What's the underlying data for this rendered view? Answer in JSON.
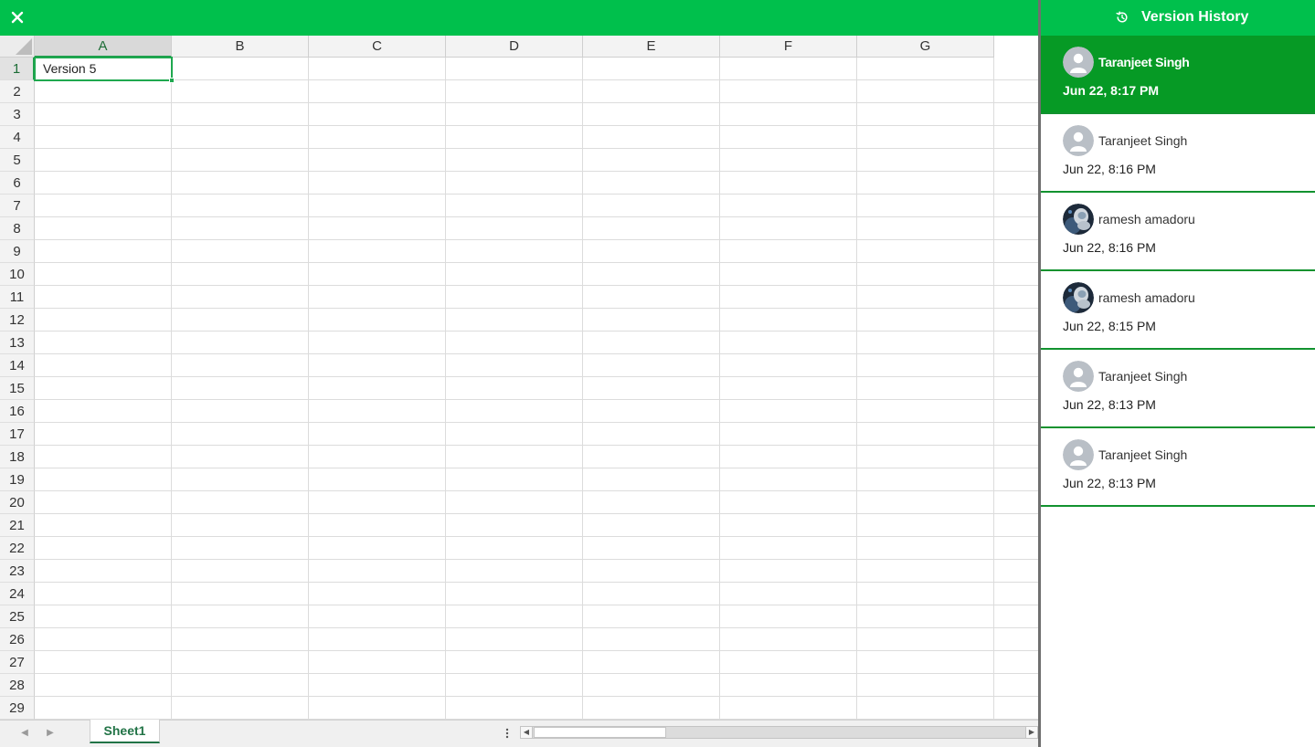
{
  "app": {
    "close_icon": "close-icon"
  },
  "sheet": {
    "columns": [
      "A",
      "B",
      "C",
      "D",
      "E",
      "F",
      "G"
    ],
    "rows": [
      "1",
      "2",
      "3",
      "4",
      "5",
      "6",
      "7",
      "8",
      "9",
      "10",
      "11",
      "12",
      "13",
      "14",
      "15",
      "16",
      "17",
      "18",
      "19",
      "20",
      "21",
      "22",
      "23",
      "24",
      "25",
      "26",
      "27",
      "28",
      "29"
    ],
    "selected_cell": "A1",
    "cells": [
      {
        "ref": "A1",
        "value": "Version 5"
      }
    ],
    "active_tab": "Sheet1"
  },
  "colors": {
    "accent_green": "#00c04c",
    "active_item_green": "#069a25",
    "sheet_tab_green": "#217346"
  },
  "version_history": {
    "title": "Version History",
    "header_icon": "history-icon",
    "items": [
      {
        "author": "Taranjeet Singh",
        "date": "Jun 22, 8:17 PM",
        "avatar": "default-avatar-icon",
        "active": true
      },
      {
        "author": "Taranjeet Singh",
        "date": "Jun 22, 8:16 PM",
        "avatar": "default-avatar-icon",
        "active": false
      },
      {
        "author": "ramesh amadoru",
        "date": "Jun 22, 8:16 PM",
        "avatar": "photo-avatar",
        "active": false
      },
      {
        "author": "ramesh amadoru",
        "date": "Jun 22, 8:15 PM",
        "avatar": "photo-avatar",
        "active": false
      },
      {
        "author": "Taranjeet Singh",
        "date": "Jun 22, 8:13 PM",
        "avatar": "default-avatar-icon",
        "active": false
      },
      {
        "author": "Taranjeet Singh",
        "date": "Jun 22, 8:13 PM",
        "avatar": "default-avatar-icon",
        "active": false
      }
    ]
  }
}
